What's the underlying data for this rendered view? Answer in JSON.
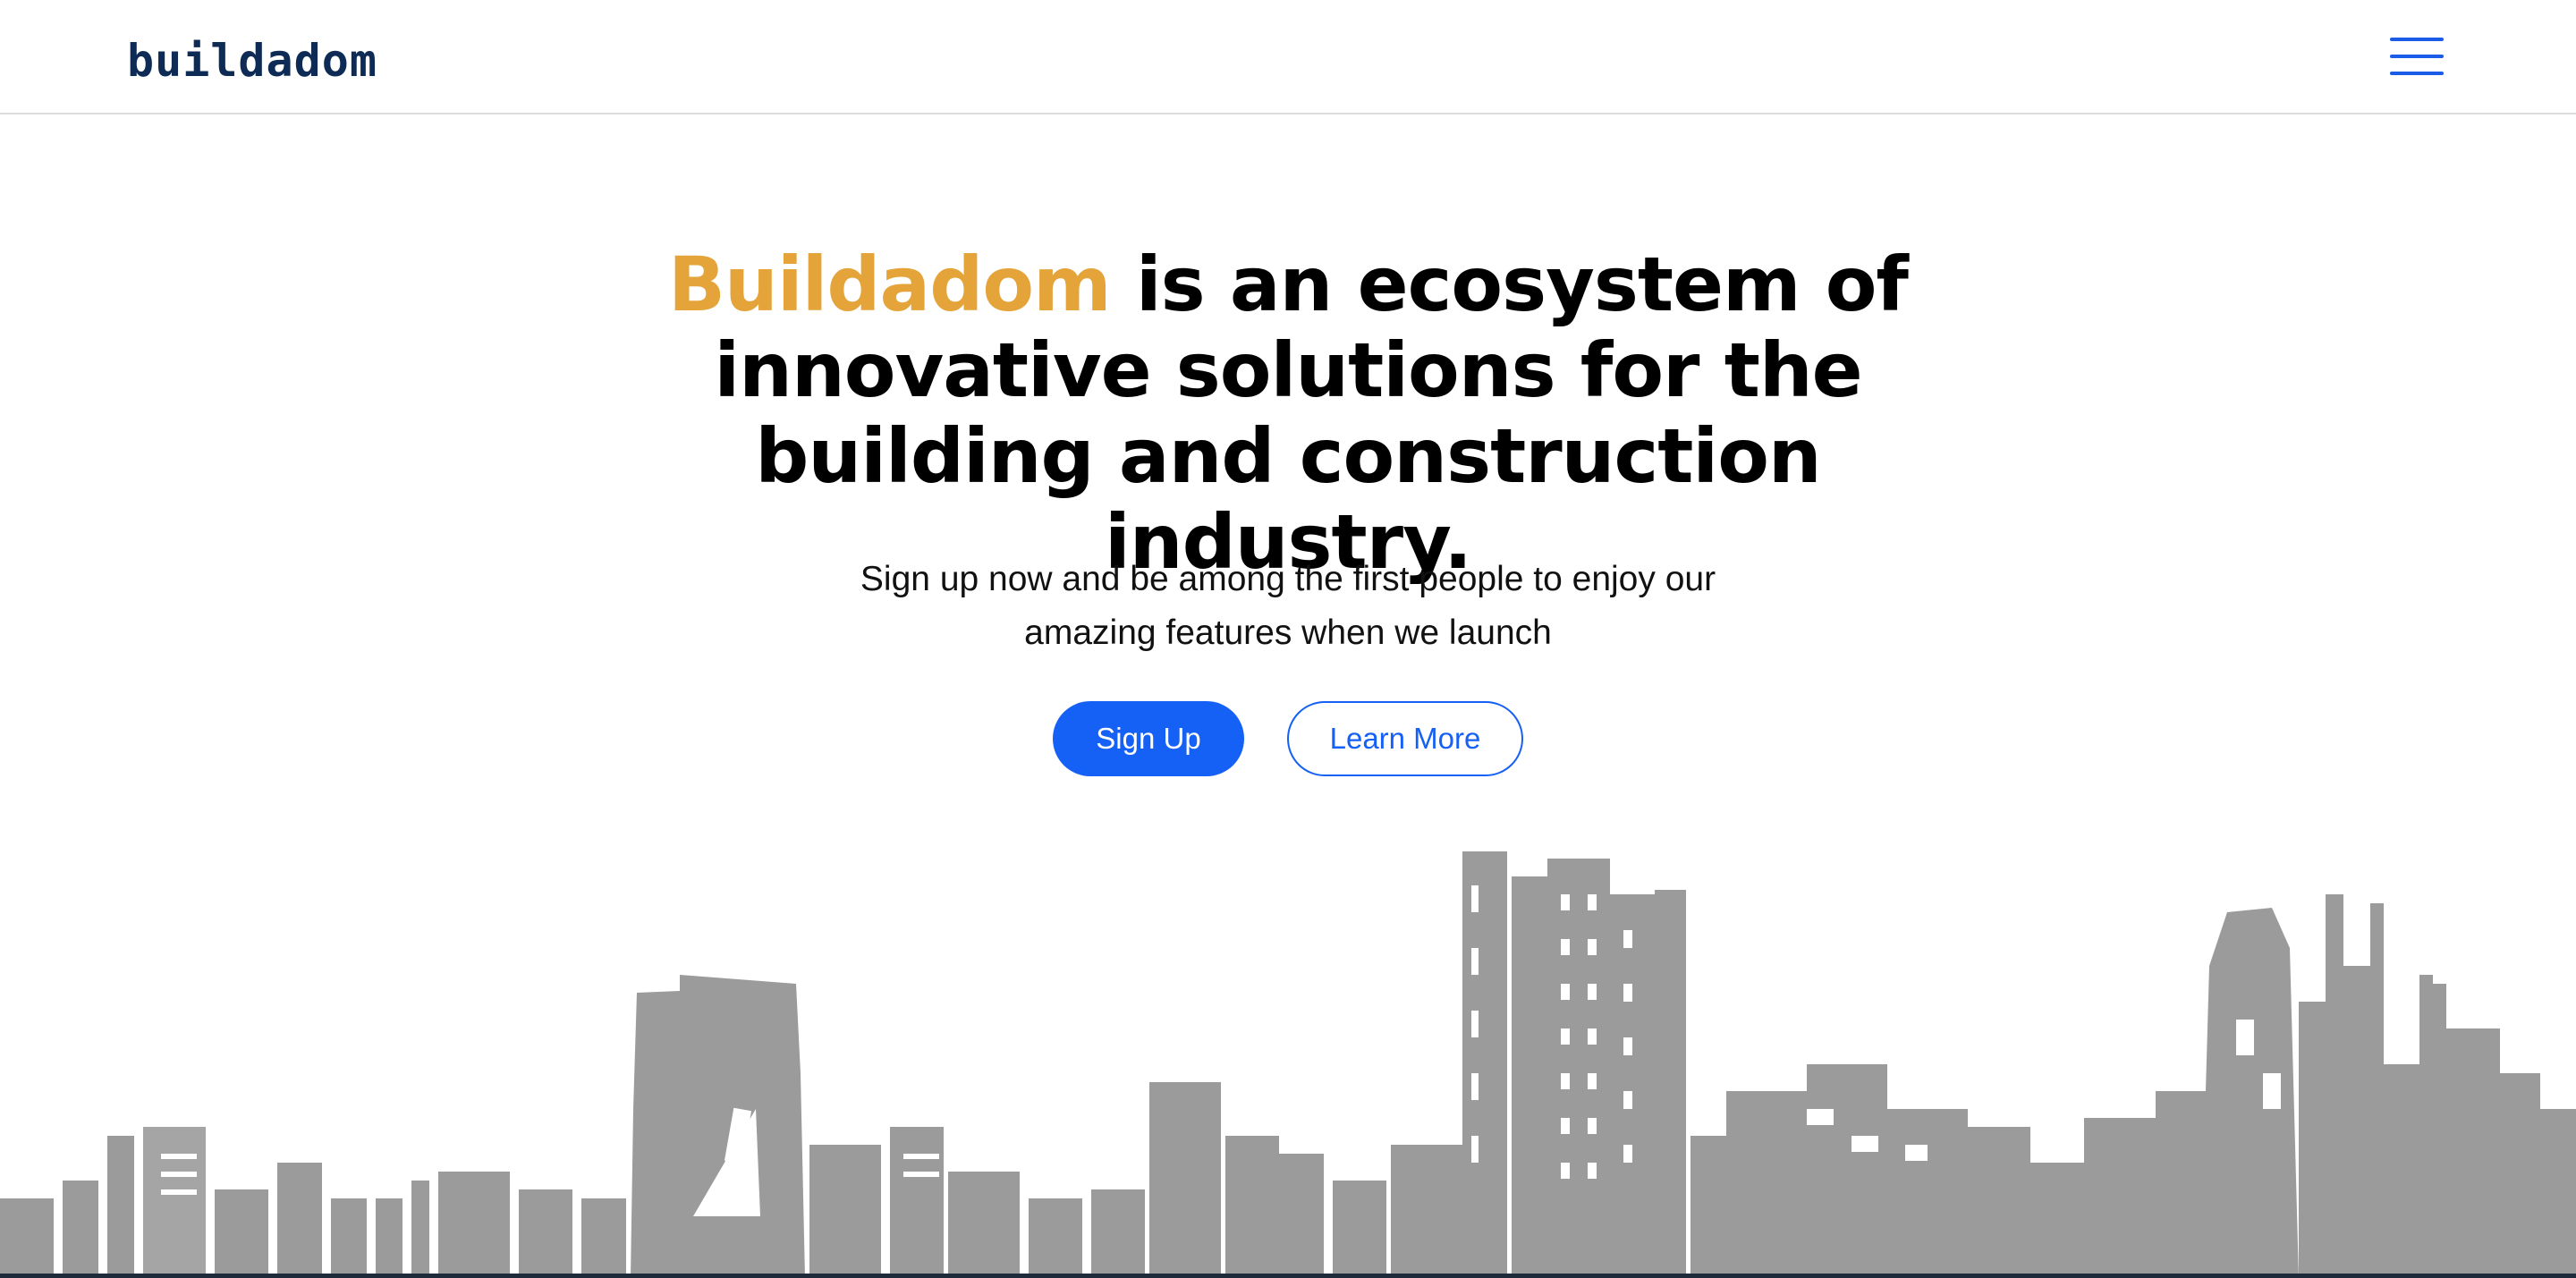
{
  "header": {
    "logo_text": "buildadom",
    "menu_icon": "hamburger-menu-icon",
    "brand_color": "#0d2b55",
    "accent_color": "#1a5be8"
  },
  "hero": {
    "headline_brand": "Buildadom",
    "headline_rest": " is an ecosystem of innovative solutions for the building and construction industry.",
    "brand_color": "#e5a43a",
    "subtitle": "Sign up now and be among the first people to enjoy our amazing features when we launch",
    "primary_button": "Sign Up",
    "secondary_button": "Learn More",
    "button_color": "#1560f5"
  },
  "illustration": {
    "icon": "city-skyline-illustration",
    "color": "#9a9a9a"
  }
}
